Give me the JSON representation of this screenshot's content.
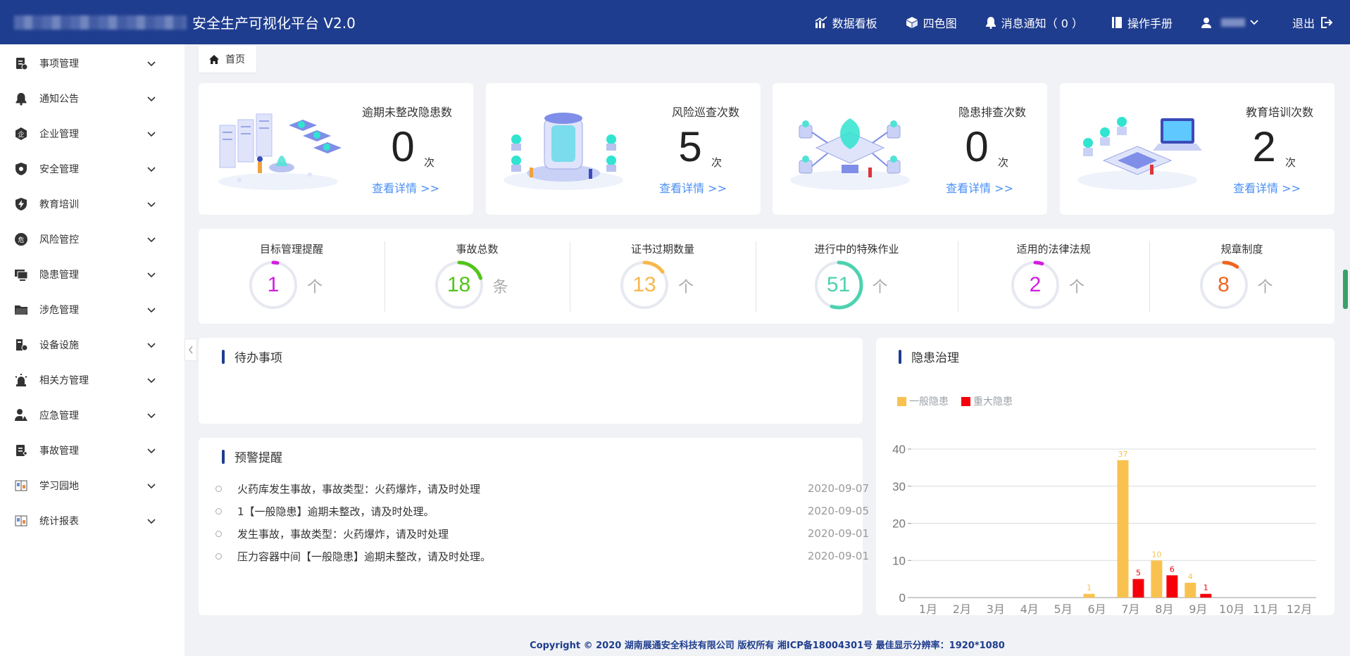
{
  "header": {
    "title": "安全生产可视化平台  V2.0",
    "nav": {
      "dashboard": "数据看板",
      "four_color": "四色图",
      "notify": "消息通知（ 0 ）",
      "manual": "操作手册",
      "logout": "退出"
    }
  },
  "sidebar": {
    "items": [
      {
        "label": "事项管理",
        "icon": "document-list-icon"
      },
      {
        "label": "通知公告",
        "icon": "bell-icon"
      },
      {
        "label": "企业管理",
        "icon": "enterprise-icon"
      },
      {
        "label": "安全管理",
        "icon": "shield-icon"
      },
      {
        "label": "教育培训",
        "icon": "lightning-shield-icon"
      },
      {
        "label": "风险管控",
        "icon": "danger-badge-icon"
      },
      {
        "label": "隐患管理",
        "icon": "monitor-icon"
      },
      {
        "label": "涉危管理",
        "icon": "folder-icon"
      },
      {
        "label": "设备设施",
        "icon": "equipment-icon"
      },
      {
        "label": "相关方管理",
        "icon": "alarm-light-icon"
      },
      {
        "label": "应急管理",
        "icon": "emergency-person-icon"
      },
      {
        "label": "事故管理",
        "icon": "report-icon"
      },
      {
        "label": "学习园地",
        "icon": "book-icon"
      },
      {
        "label": "统计报表",
        "icon": "book-icon"
      }
    ]
  },
  "breadcrumb": {
    "home": "首页"
  },
  "stat_cards": [
    {
      "title": "逾期未整改隐患数",
      "value": "0",
      "unit": "次",
      "link": "查看详情 >>"
    },
    {
      "title": "风险巡查次数",
      "value": "5",
      "unit": "次",
      "link": "查看详情 >>"
    },
    {
      "title": "隐患排查次数",
      "value": "0",
      "unit": "次",
      "link": "查看详情 >>"
    },
    {
      "title": "教育培训次数",
      "value": "2",
      "unit": "次",
      "link": "查看详情 >>"
    }
  ],
  "rings": [
    {
      "label": "目标管理提醒",
      "value": "1",
      "unit": "个",
      "color": "#d21ee0",
      "fraction": 0.03
    },
    {
      "label": "事故总数",
      "value": "18",
      "unit": "条",
      "color": "#52c41a",
      "fraction": 0.2
    },
    {
      "label": "证书过期数量",
      "value": "13",
      "unit": "个",
      "color": "#f7b84b",
      "fraction": 0.15
    },
    {
      "label": "进行中的特殊作业",
      "value": "51",
      "unit": "个",
      "color": "#4dd2b0",
      "fraction": 0.55
    },
    {
      "label": "适用的法律法规",
      "value": "2",
      "unit": "个",
      "color": "#d21ee0",
      "fraction": 0.05
    },
    {
      "label": "规章制度",
      "value": "8",
      "unit": "个",
      "color": "#f0641e",
      "fraction": 0.1
    }
  ],
  "todo": {
    "title": "待办事项"
  },
  "warnings": {
    "title": "预警提醒",
    "items": [
      {
        "text": "火药库发生事故，事故类型：火药爆炸，请及时处理",
        "date": "2020-09-07"
      },
      {
        "text": "1【一般隐患】逾期未整改，请及时处理。",
        "date": "2020-09-05"
      },
      {
        "text": "发生事故，事故类型：火药爆炸，请及时处理",
        "date": "2020-09-01"
      },
      {
        "text": "压力容器中间【一般隐患】逾期未整改，请及时处理。",
        "date": "2020-09-01"
      }
    ]
  },
  "hazard_panel": {
    "title": "隐患治理"
  },
  "chart_data": {
    "type": "bar",
    "categories": [
      "1月",
      "2月",
      "3月",
      "4月",
      "5月",
      "6月",
      "7月",
      "8月",
      "9月",
      "10月",
      "11月",
      "12月"
    ],
    "series": [
      {
        "name": "一般隐患",
        "color": "#f9c24f",
        "values": [
          0,
          0,
          0,
          0,
          0,
          1,
          37,
          10,
          4,
          0,
          0,
          0
        ]
      },
      {
        "name": "重大隐患",
        "color": "#f5000a",
        "values": [
          0,
          0,
          0,
          0,
          0,
          0,
          5,
          6,
          1,
          0,
          0,
          0
        ]
      }
    ],
    "ylim": [
      0,
      40
    ],
    "yticks": [
      0,
      10,
      20,
      30,
      40
    ],
    "grid": true,
    "legend": "top-left"
  },
  "footer": {
    "text": "Copyright © 2020 湖南展通安全科技有限公司 版权所有 湘ICP备18004301号 最佳显示分辨率：1920*1080"
  }
}
